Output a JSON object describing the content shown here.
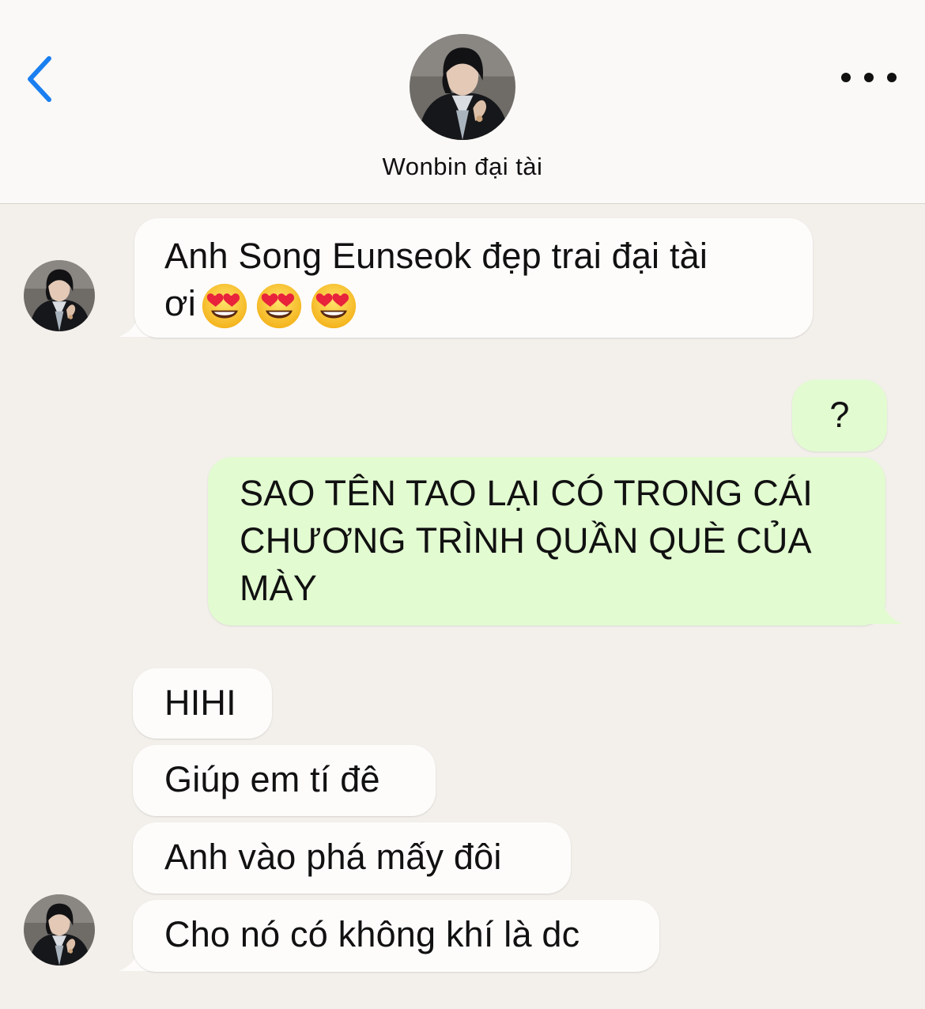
{
  "header": {
    "back_icon": "chevron-left-icon",
    "contact_name": "Wonbin đại tài",
    "more_icon": "ellipsis-horizontal-icon",
    "accent_color": "#1a7ff0"
  },
  "messages": [
    {
      "from": "contact",
      "text_line1": "Anh Song Eunseok đẹp trai đại tài",
      "text_line2": "ơi",
      "emoji": "heart-eyes-emoji",
      "emoji_count": 3
    },
    {
      "from": "me",
      "text": "?"
    },
    {
      "from": "me",
      "text_line1": "SAO TÊN TAO LẠI CÓ TRONG CÁI",
      "text_line2": "CHƯƠNG TRÌNH QUẦN QUÈ CỦA",
      "text_line3": "MÀY"
    },
    {
      "from": "contact",
      "text": "HIHI"
    },
    {
      "from": "contact",
      "text": "Giúp em tí đê"
    },
    {
      "from": "contact",
      "text": "Anh vào phá mấy đôi"
    },
    {
      "from": "contact",
      "text": "Cho nó có không khí là dc"
    }
  ],
  "colors": {
    "incoming_bubble": "#fdfcfb",
    "outgoing_bubble": "#e2fbd1",
    "chat_background": "#f3f0eb",
    "header_background": "#faf9f7"
  }
}
